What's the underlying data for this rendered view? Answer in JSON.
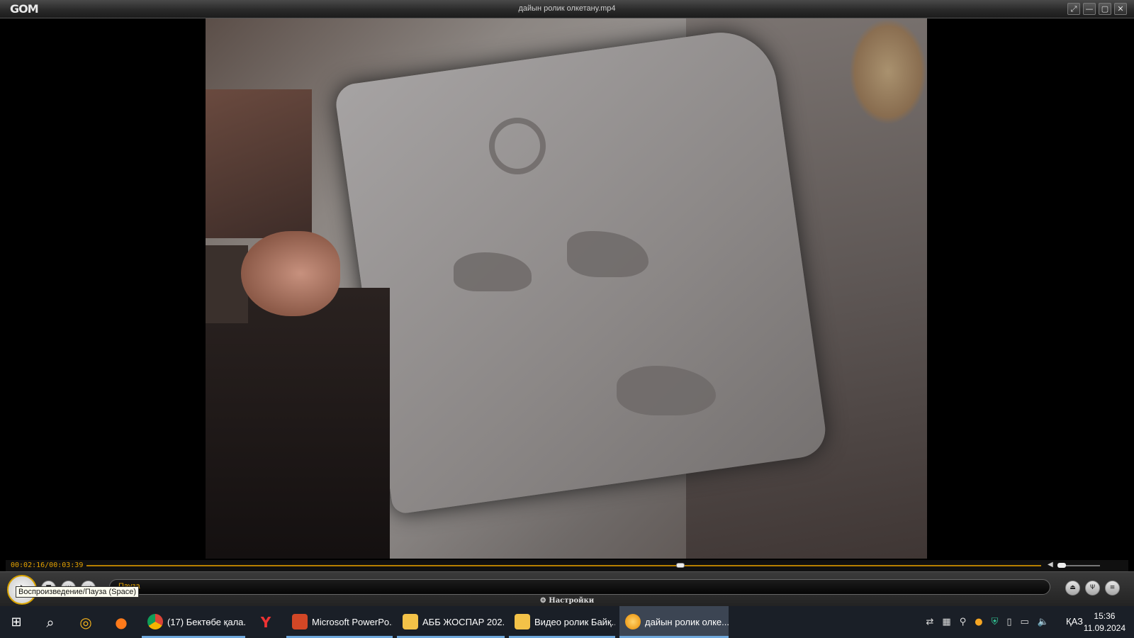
{
  "window": {
    "logo": "GOM",
    "title": "дайын ролик олкетану.mp4",
    "buttons": [
      "⤢",
      "—",
      "▢",
      "✕"
    ]
  },
  "playback": {
    "time": "00:02:16/00:03:39",
    "progress_fraction": 0.622,
    "volume_fraction": 0.1
  },
  "controls": {
    "status": "Пауза",
    "settings": "Настройки",
    "tooltip": "Воспроизведение/Пауза (Space)",
    "stop_icon": "■",
    "prev_icon": "⏮",
    "next_icon": "⏭",
    "eject_icon": "⏏",
    "equalizer_icon": "Ψ",
    "menu_icon": "≡"
  },
  "taskbar": {
    "apps": [
      {
        "label": "(17) Бектөбе қала...",
        "color": "#db4437"
      },
      {
        "label": "Microsoft PowerPo...",
        "color": "#d24726"
      },
      {
        "label": "АББ ЖОСПАР 202...",
        "color": "#f3c248"
      },
      {
        "label": "Видео ролик Байқ...",
        "color": "#f3c248"
      },
      {
        "label": "дайын ролик олке...",
        "color": "#f6a623"
      }
    ],
    "language": "ҚАЗ",
    "time": "15:36",
    "date": "11.09.2024"
  }
}
